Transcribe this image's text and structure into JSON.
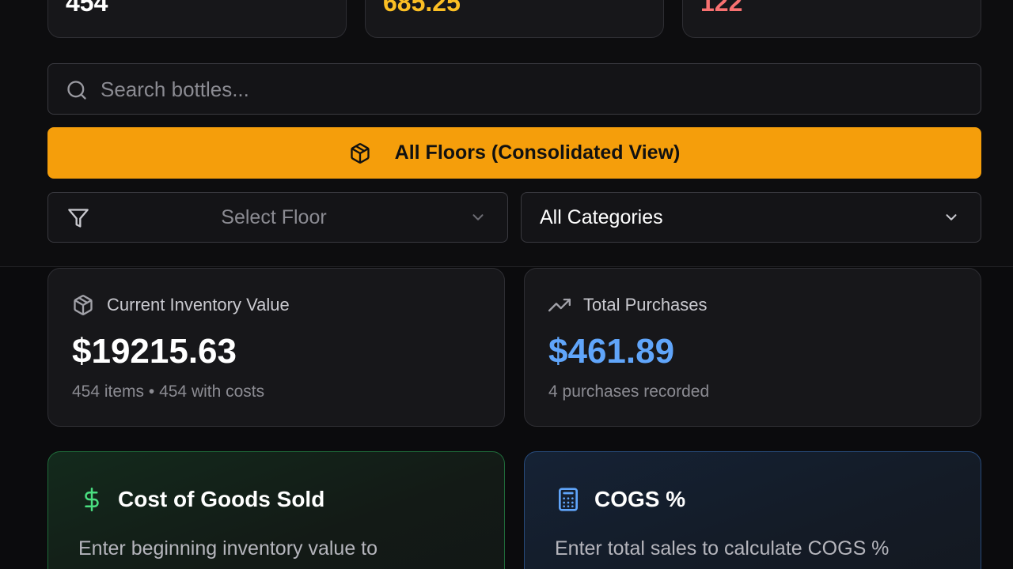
{
  "stats": {
    "total_items": "454",
    "amber_value": "685.25",
    "red_value": "122",
    "colors": {
      "white": "#ffffff",
      "amber": "#fbbf24",
      "red": "#f87171"
    }
  },
  "search": {
    "placeholder": "Search bottles..."
  },
  "floors_button": {
    "label": "All Floors (Consolidated View)",
    "color": "#f59e0b"
  },
  "filters": {
    "floor_select": {
      "placeholder": "Select Floor"
    },
    "category_select": {
      "value": "All Categories"
    }
  },
  "metrics": {
    "inventory": {
      "title": "Current Inventory Value",
      "value": "$19215.63",
      "subtitle": "454 items • 454 with costs"
    },
    "purchases": {
      "title": "Total Purchases",
      "value": "$461.89",
      "subtitle": "4 purchases recorded",
      "accent": "#60a5fa"
    }
  },
  "cogs": {
    "title": "Cost of Goods Sold",
    "description": "Enter beginning inventory value to",
    "accent": "#4ade80"
  },
  "cogs_percent": {
    "title": "COGS %",
    "description": "Enter total sales to calculate COGS %",
    "accent": "#60a5fa"
  },
  "icons": [
    "search-icon",
    "package-icon",
    "filter-icon",
    "chevron-down-icon",
    "trending-up-icon",
    "dollar-sign-icon",
    "calculator-icon"
  ]
}
